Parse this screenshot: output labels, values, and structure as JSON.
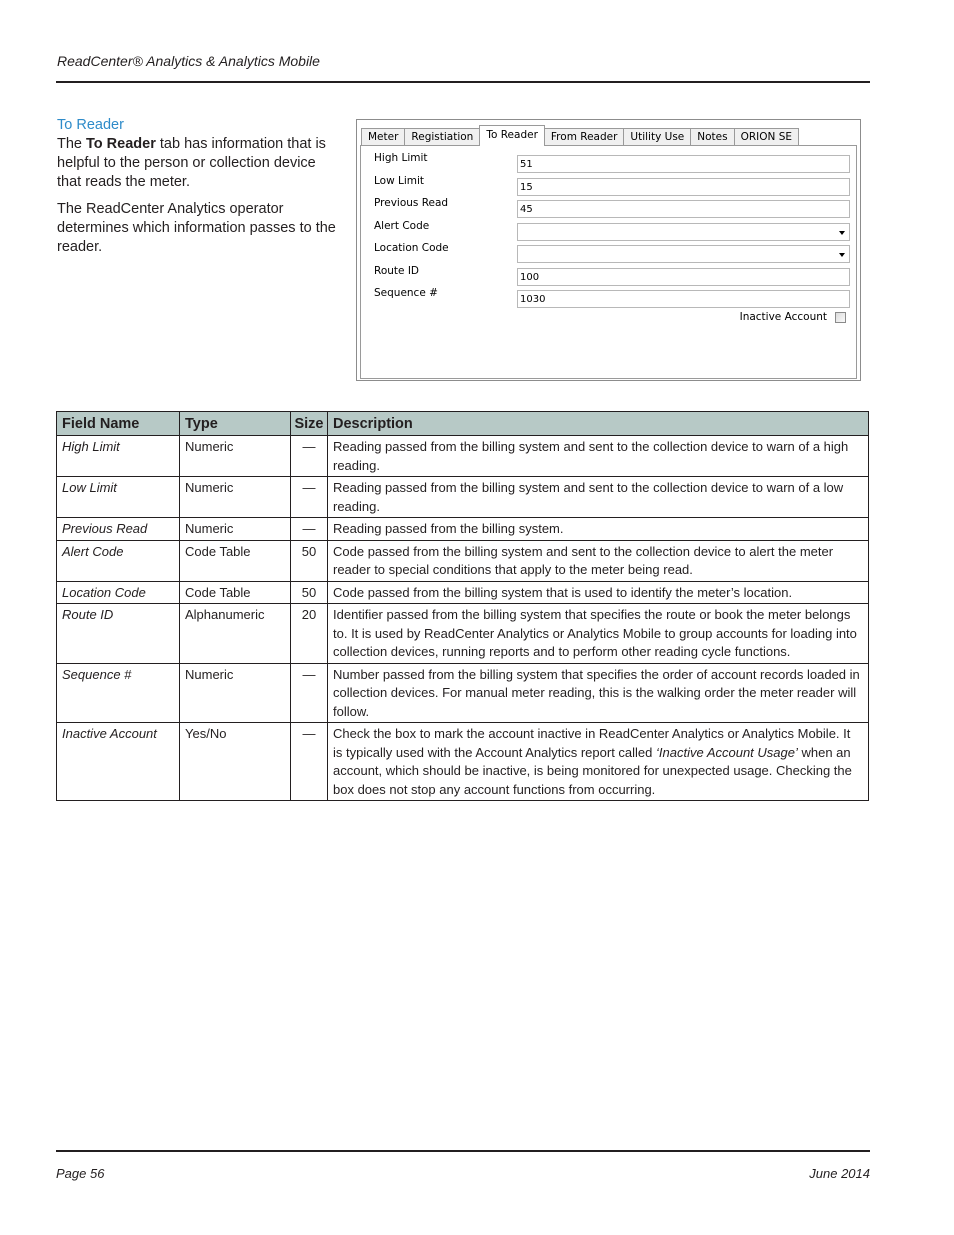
{
  "header": {
    "running_title": "ReadCenter® Analytics & Analytics Mobile"
  },
  "intro": {
    "heading": "To Reader",
    "p1_before": "The ",
    "p1_bold": "To Reader",
    "p1_after": " tab has information that is helpful to the person or collection device that reads the meter.",
    "p2": "The ReadCenter Analytics operator determines which information passes to the reader."
  },
  "dialog": {
    "tabs": [
      {
        "label": "Meter",
        "active": false
      },
      {
        "label": "Registiation",
        "active": false
      },
      {
        "label": "To Reader",
        "active": true
      },
      {
        "label": "From Reader",
        "active": false
      },
      {
        "label": "Utility Use",
        "active": false
      },
      {
        "label": "Notes",
        "active": false
      },
      {
        "label": "ORION SE",
        "active": false
      }
    ],
    "fields": [
      {
        "label": "High Limit",
        "value": "51",
        "kind": "text"
      },
      {
        "label": "Low Limit",
        "value": "15",
        "kind": "text"
      },
      {
        "label": "Previous Read",
        "value": "45",
        "kind": "text"
      },
      {
        "label": "Alert Code",
        "value": "",
        "kind": "select"
      },
      {
        "label": "Location Code",
        "value": "",
        "kind": "select"
      },
      {
        "label": "Route ID",
        "value": "100",
        "kind": "text"
      },
      {
        "label": "Sequence #",
        "value": "1030",
        "kind": "text"
      }
    ],
    "inactive_account": {
      "label": "Inactive Account",
      "checked": false
    }
  },
  "table": {
    "headers": [
      "Field Name",
      "Type",
      "Size",
      "Description"
    ],
    "rows": [
      {
        "name": "High Limit",
        "type": "Numeric",
        "size": "—",
        "desc": "Reading passed from the billing system and sent to the collection device to warn of a high reading."
      },
      {
        "name": "Low Limit",
        "type": "Numeric",
        "size": "—",
        "desc": "Reading passed from the billing system and sent to the collection device to warn of a low reading."
      },
      {
        "name": "Previous Read",
        "type": "Numeric",
        "size": "—",
        "desc": "Reading passed from the billing system."
      },
      {
        "name": "Alert Code",
        "type": "Code Table",
        "size": "50",
        "desc": "Code passed from the billing system and sent to the collection device to alert the meter reader to special conditions that apply to the meter being read."
      },
      {
        "name": "Location Code",
        "type": "Code Table",
        "size": "50",
        "desc": "Code passed from the billing system that is used to identify the meter’s location."
      },
      {
        "name": "Route ID",
        "type": "Alphanumeric",
        "size": "20",
        "desc": "Identifier passed from the billing system that specifies the route or book the meter belongs to. It is used by ReadCenter Analytics or Analytics Mobile to group accounts for loading into collection devices, running reports and to perform other reading cycle functions."
      },
      {
        "name": "Sequence #",
        "type": "Numeric",
        "size": "—",
        "desc": "Number passed from the billing system that specifies the order of account records loaded in collection devices. For manual meter reading, this is the walking order the meter reader will follow."
      },
      {
        "name": "Inactive Account",
        "type": "Yes/No",
        "size": "—",
        "desc_before": "Check the box to mark the account inactive in ReadCenter Analytics or Analytics Mobile. It is typically used with the Account Analytics report called ",
        "desc_em": "‘Inactive Account Usage’",
        "desc_after": " when an account, which should be inactive, is being monitored for unexpected usage. Checking the box does not stop any account functions from occurring."
      }
    ]
  },
  "footer": {
    "page": "Page 56",
    "date": "June 2014"
  }
}
